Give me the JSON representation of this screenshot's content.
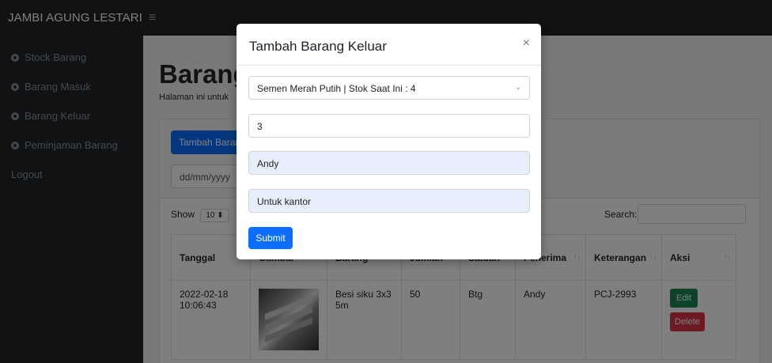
{
  "topbar": {
    "brand": "JAMBI AGUNG LESTARI",
    "toggle_icon": "≡"
  },
  "sidebar": {
    "items": [
      {
        "label": "Stock Barang"
      },
      {
        "label": "Barang Masuk"
      },
      {
        "label": "Barang Keluar"
      },
      {
        "label": "Peminjaman Barang"
      }
    ],
    "logout": "Logout"
  },
  "page": {
    "title": "Barang",
    "subtitle": "Halaman ini untuk",
    "add_button": "Tambah Baran",
    "date_placeholder": "dd/mm/yyyy",
    "show_label": "Show",
    "show_value": "10 ⬍",
    "search_label": "Search:"
  },
  "table": {
    "headers": [
      "Tanggal",
      "Gambar",
      "Barang",
      "Jumlah",
      "Satuan",
      "Penerima",
      "Keterangan",
      "Aksi"
    ],
    "sort_icon": "↑↓",
    "rows": [
      {
        "tanggal": "2022-02-18 10:06:43",
        "barang": "Besi siku 3x3 5m",
        "jumlah": "50",
        "satuan": "Btg",
        "penerima": "Andy",
        "keterangan": "PCJ-2993",
        "edit": "Edit",
        "delete": "Delete"
      }
    ]
  },
  "modal": {
    "title": "Tambah Barang Keluar",
    "close": "×",
    "select_value": "Semen Merah Putih | Stok Saat Ini : 4",
    "qty_value": "3",
    "penerima_value": "Andy",
    "keterangan_value": "Untuk kantor",
    "submit": "Submit"
  }
}
